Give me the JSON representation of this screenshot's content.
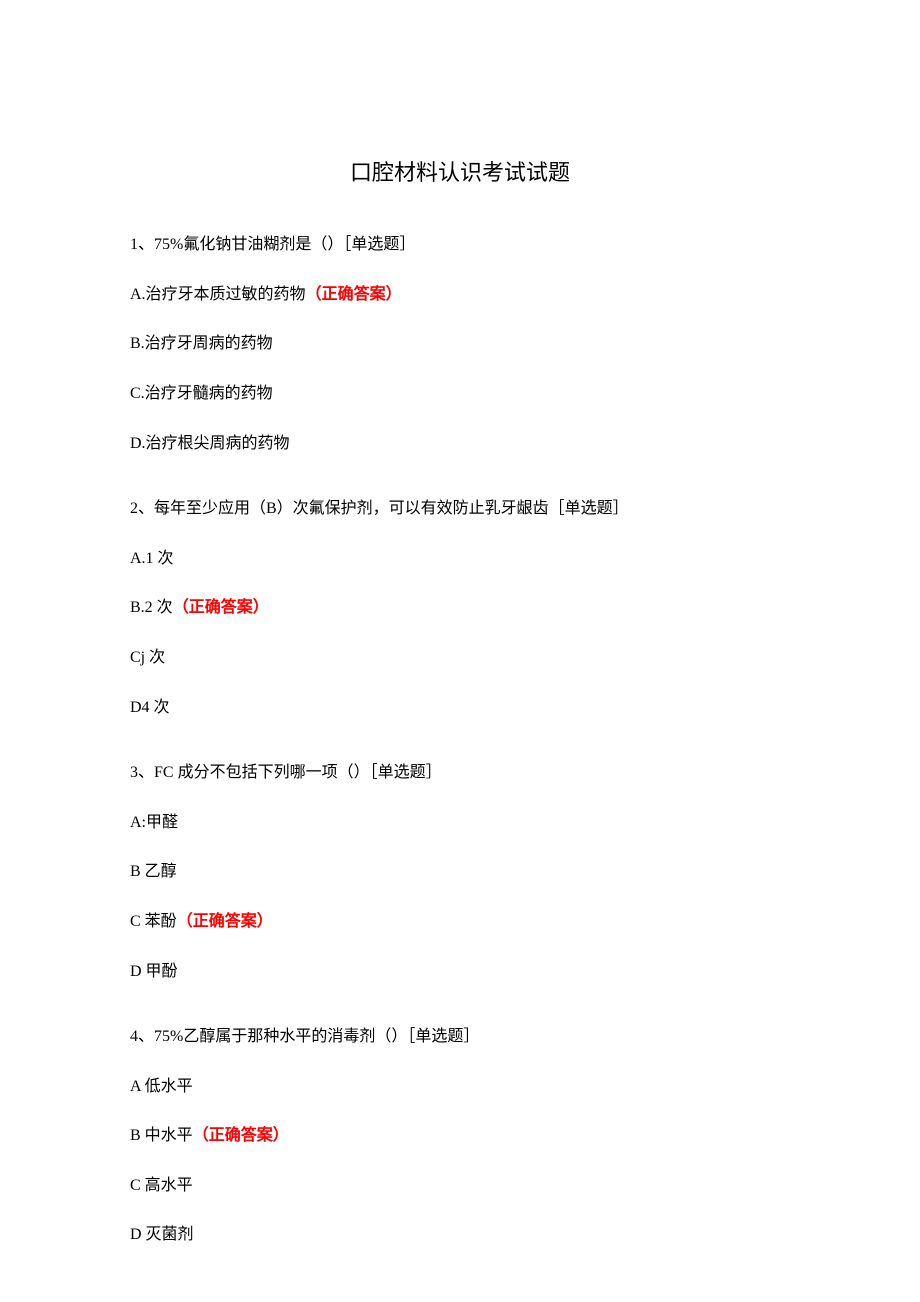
{
  "title": "口腔材料认识考试试题",
  "correct_label": "（正确答案）",
  "questions": [
    {
      "text": "1、75%氟化钠甘油糊剂是（）［单选题］",
      "options": [
        {
          "prefix": "A.治疗牙本质过敏的药物",
          "correct": true
        },
        {
          "prefix": "B.治疗牙周病的药物",
          "correct": false
        },
        {
          "prefix": "C.治疗牙髓病的药物",
          "correct": false
        },
        {
          "prefix": "D.治疗根尖周病的药物",
          "correct": false
        }
      ]
    },
    {
      "text": "2、每年至少应用（B）次氟保护剂，可以有效防止乳牙龈齿［单选题］",
      "options": [
        {
          "prefix": "A.1 次",
          "correct": false
        },
        {
          "prefix": "B.2 次",
          "correct": true
        },
        {
          "prefix": "Cj 次",
          "correct": false
        },
        {
          "prefix": "D4 次",
          "correct": false
        }
      ]
    },
    {
      "text": "3、FC 成分不包括下列哪一项（）［单选题］",
      "options": [
        {
          "prefix": "A:甲醛",
          "correct": false
        },
        {
          "prefix": "B 乙醇",
          "correct": false
        },
        {
          "prefix": "C 苯酚",
          "correct": true
        },
        {
          "prefix": "D 甲酚",
          "correct": false
        }
      ]
    },
    {
      "text": "4、75%乙醇属于那种水平的消毒剂（）［单选题］",
      "options": [
        {
          "prefix": "A 低水平",
          "correct": false
        },
        {
          "prefix": "B 中水平",
          "correct": true
        },
        {
          "prefix": "C 高水平",
          "correct": false
        },
        {
          "prefix": "D 灭菌剂",
          "correct": false
        }
      ]
    }
  ]
}
